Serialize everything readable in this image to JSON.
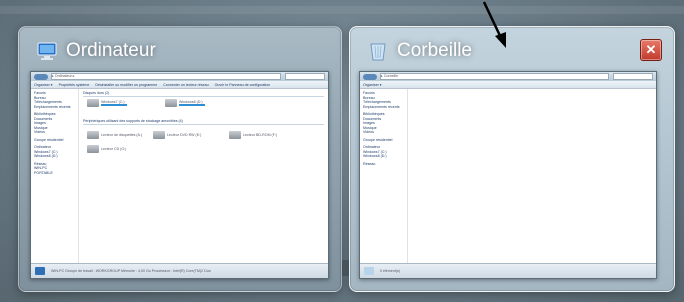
{
  "cards": {
    "computer": {
      "title": "Ordinateur",
      "icon": "computer-icon",
      "thumb": {
        "address": "▸ Ordinateur ▸",
        "commands": [
          "Organiser ▾",
          "Propriétés système",
          "Désinstaller ou modifier un programme",
          "Connecter un lecteur réseau",
          "Ouvrir le Panneau de configuration"
        ],
        "nav_items": [
          "Favoris",
          "Bureau",
          "Téléchargements",
          "Emplacements récents",
          "",
          "Bibliothèques",
          "Documents",
          "Images",
          "Musique",
          "Vidéos",
          "",
          "Groupe résidentiel",
          "",
          "Ordinateur",
          "Windows7 (C:)",
          "Windows8 (D:)",
          "",
          "Réseau",
          "WIN-PC",
          "PORTABLE"
        ],
        "group_disks": "Disques durs (2)",
        "group_removable": "Périphériques utilisant des supports de stockage amovibles (4)",
        "drives": [
          "Windows7 (C:)",
          "Windows8 (D:)",
          "Lecteur de disquettes (A:)",
          "Lecteur DVD RW (E:)",
          "Lecteur BD-ROM (F:)",
          "Lecteur CD (G:)"
        ],
        "status": "WIN-PC   Groupe de travail : WORKGROUP   Mémoire : 4,00 Go   Processeur : Intel(R) Core(TM)2 Duo"
      }
    },
    "recycle": {
      "title": "Corbeille",
      "icon": "recycle-bin-icon",
      "close_label": "✕",
      "thumb": {
        "address": "▸ Corbeille",
        "commands": [
          "Organiser ▾"
        ],
        "nav_items": [
          "Favoris",
          "Bureau",
          "Téléchargements",
          "Emplacements récents",
          "",
          "Bibliothèques",
          "Documents",
          "Images",
          "Musique",
          "Vidéos",
          "",
          "Groupe résidentiel",
          "",
          "Ordinateur",
          "Windows7 (C:)",
          "Windows8 (D:)",
          "",
          "Réseau"
        ],
        "status": "0 élément(s)"
      }
    }
  },
  "colors": {
    "close": "#c0392b",
    "accent": "#2d8ed3"
  }
}
